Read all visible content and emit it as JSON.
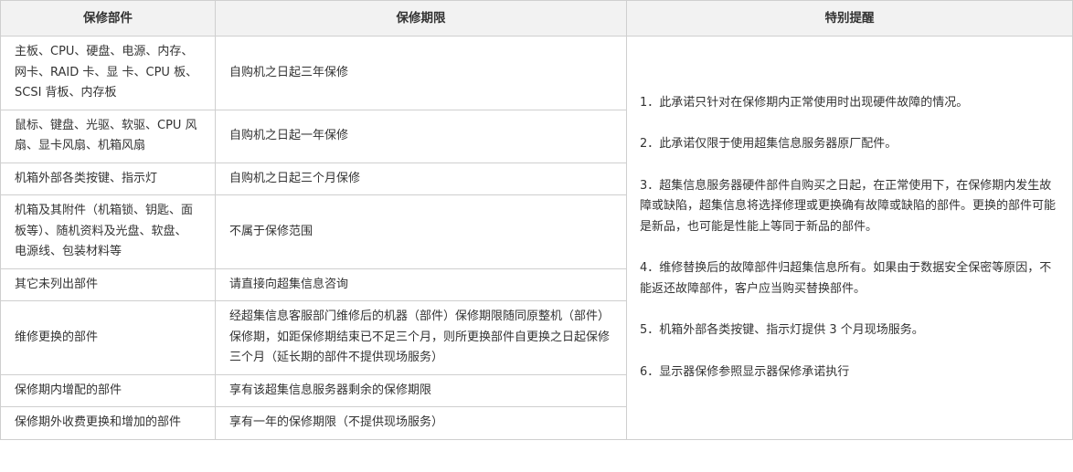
{
  "header": {
    "col_part": "保修部件",
    "col_period": "保修期限",
    "col_notes": "特别提醒"
  },
  "rows": [
    {
      "part": "主板、CPU、硬盘、电源、内存、网卡、RAID 卡、显 卡、CPU 板、SCSI 背板、内存板",
      "period": "自购机之日起三年保修"
    },
    {
      "part": "鼠标、键盘、光驱、软驱、CPU 风扇、显卡风扇、机箱风扇",
      "period": "自购机之日起一年保修"
    },
    {
      "part": "机箱外部各类按键、指示灯",
      "period": "自购机之日起三个月保修"
    },
    {
      "part": "机箱及其附件（机箱锁、钥匙、面板等）、随机资料及光盘、软盘、电源线、包装材料等",
      "period": "不属于保修范围"
    },
    {
      "part": "其它未列出部件",
      "period": "请直接向超集信息咨询"
    },
    {
      "part": "维修更换的部件",
      "period": "经超集信息客服部门维修后的机器（部件）保修期限随同原整机（部件）保修期，如距保修期结束已不足三个月，则所更换部件自更换之日起保修三个月（延长期的部件不提供现场服务）"
    },
    {
      "part": "保修期内增配的部件",
      "period": "享有该超集信息服务器剩余的保修期限"
    },
    {
      "part": "保修期外收费更换和增加的部件",
      "period": "享有一年的保修期限（不提供现场服务）"
    }
  ],
  "notes": [
    "1．此承诺只针对在保修期内正常使用时出现硬件故障的情况。",
    "2．此承诺仅限于使用超集信息服务器原厂配件。",
    "3．超集信息服务器硬件部件自购买之日起，在正常使用下，在保修期内发生故障或缺陷，超集信息将选择修理或更换确有故障或缺陷的部件。更换的部件可能是新品，也可能是性能上等同于新品的部件。",
    "4．维修替换后的故障部件归超集信息所有。如果由于数据安全保密等原因，不能返还故障部件，客户应当购买替换部件。",
    "5．机箱外部各类按键、指示灯提供 3 个月现场服务。",
    "6．显示器保修参照显示器保修承诺执行"
  ]
}
